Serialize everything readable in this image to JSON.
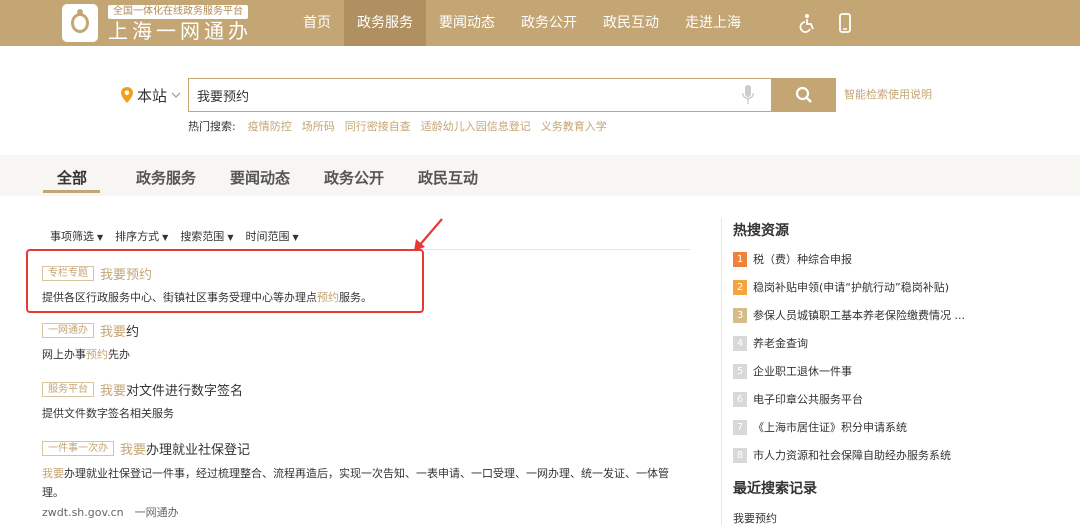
{
  "header": {
    "logo_tag": "全国一体化在线政务服务平台",
    "logo_name": "上海一网通办",
    "nav": [
      "首页",
      "政务服务",
      "要闻动态",
      "政务公开",
      "政民互动",
      "走进上海"
    ],
    "active_nav": 1
  },
  "search": {
    "location": "本站",
    "query": "我要预约",
    "help_link": "智能检索使用说明",
    "hot_label": "热门搜索:",
    "hot_terms": [
      "疫情防控",
      "场所码",
      "同行密接自查",
      "适龄幼儿入园信息登记",
      "义务教育入学"
    ]
  },
  "tabs": [
    "全部",
    "政务服务",
    "要闻动态",
    "政务公开",
    "政民互动"
  ],
  "filters": [
    "事项筛选",
    "排序方式",
    "搜索范围",
    "时间范围"
  ],
  "results": [
    {
      "badge": "专栏专题",
      "title_hl": "我要预约",
      "title_rest": "",
      "desc_a": "提供各区行政服务中心、街镇社区事务受理中心等办理点",
      "desc_hl": "预约",
      "desc_b": "服务。"
    },
    {
      "badge": "一网通办",
      "title_hl": "我要",
      "title_rest": "约",
      "desc_a": "网上办事",
      "desc_hl": "预约",
      "desc_b": "先办"
    },
    {
      "badge": "服务平台",
      "title_hl": "我要",
      "title_rest": "对文件进行数字签名",
      "desc": "提供文件数字签名相关服务"
    },
    {
      "badge": "一件事一次办",
      "title_hl": "我要",
      "title_rest": "办理就业社保登记",
      "desc_hl": "我要",
      "desc_rest": "办理就业社保登记一件事，经过梳理整合、流程再造后，实现一次告知、一表申请、一口受理、一网办理、统一发证、一体管理。",
      "source": "zwdt.sh.gov.cn　一网通办"
    }
  ],
  "sidebar": {
    "hot_title": "热搜资源",
    "hot_items": [
      "税（费）种综合申报",
      "稳岗补贴申领(申请“护航行动”稳岗补贴)",
      "参保人员城镇职工基本养老保险缴费情况 ...",
      "养老金查询",
      "企业职工退休一件事",
      "电子印章公共服务平台",
      "《上海市居住证》积分申请系统",
      "市人力资源和社会保障自助经办服务系统"
    ],
    "hot_numbers": [
      "1",
      "2",
      "3",
      "4",
      "5",
      "6",
      "7",
      "8"
    ],
    "recent_title": "最近搜索记录",
    "recent_items": [
      "我要预约"
    ]
  },
  "colors": {
    "brand": "#c4a574",
    "annotation": "#e53935"
  }
}
